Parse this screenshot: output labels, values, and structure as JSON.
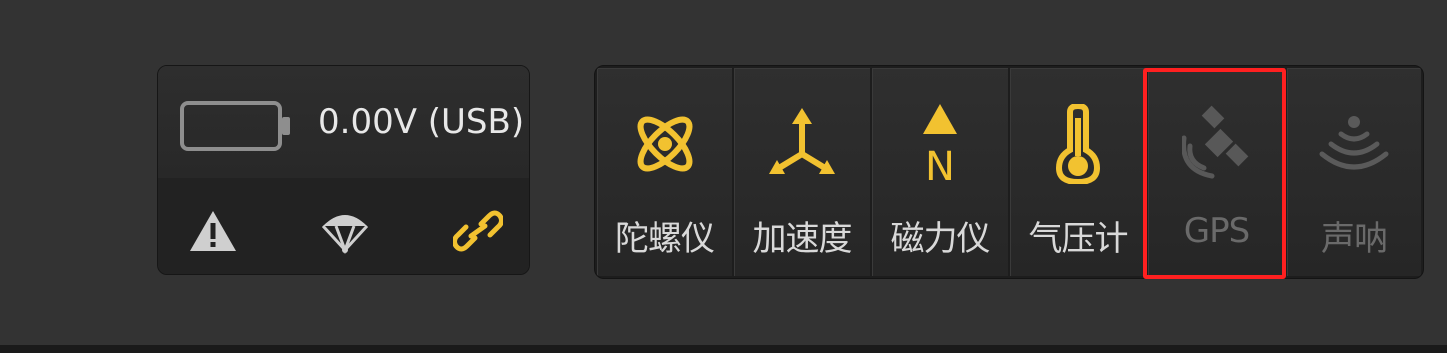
{
  "battery": {
    "voltage_text": "0.00V (USB)",
    "status_icons": [
      "warning-icon",
      "parachute-icon",
      "link-icon"
    ]
  },
  "sensors": [
    {
      "label": "陀螺仪",
      "icon": "gyroscope-icon",
      "active": true
    },
    {
      "label": "加速度",
      "icon": "accelerometer-icon",
      "active": true
    },
    {
      "label": "磁力仪",
      "icon": "magnetometer-icon",
      "active": true,
      "icon_text": "N"
    },
    {
      "label": "气压计",
      "icon": "barometer-icon",
      "active": true
    },
    {
      "label": "GPS",
      "icon": "gps-satellite-icon",
      "active": false
    },
    {
      "label": "声呐",
      "icon": "sonar-icon",
      "active": false
    }
  ],
  "colors": {
    "active_icon": "#f2c230",
    "inactive_icon": "#5a5a5a",
    "highlight": "#ff2020",
    "background": "#333333"
  }
}
